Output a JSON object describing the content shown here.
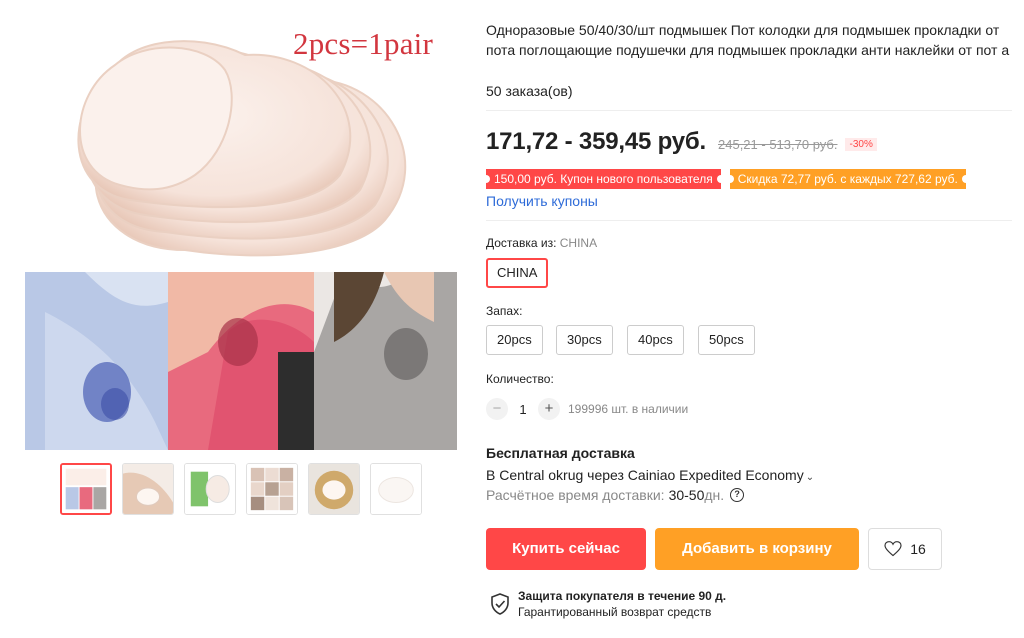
{
  "gallery": {
    "caption": "2pcs=1pair",
    "thumbnails": [
      {
        "name": "thumb-collage",
        "active": true
      },
      {
        "name": "thumb-pad-on-arm",
        "active": false
      },
      {
        "name": "thumb-pad-application",
        "active": false
      },
      {
        "name": "thumb-pad-grid",
        "active": false
      },
      {
        "name": "thumb-pad-on-plate",
        "active": false
      },
      {
        "name": "thumb-single-pad",
        "active": false
      }
    ]
  },
  "product": {
    "title": "Одноразовые 50/40/30/шт подмышек Пот колодки для подмышек прокладки от пота поглощающие подушечки для подмышек прокладки анти наклейки от пот а",
    "orders": "50 заказа(ов)",
    "price": "171,72 - 359,45 руб.",
    "old_price": "245,21 - 513,70 руб.",
    "discount": "-30%",
    "coupon_new_user": "150,00 руб. Купон нового пользователя",
    "coupon_store": "Скидка 72,77 руб. с каждых 727,62 руб.",
    "get_coupons": "Получить купоны"
  },
  "delivery_from": {
    "label": "Доставка из:",
    "value": "CHINA",
    "options": [
      "CHINA"
    ]
  },
  "scent": {
    "label": "Запах:",
    "options": [
      "20pcs",
      "30pcs",
      "40pcs",
      "50pcs"
    ]
  },
  "quantity": {
    "label": "Количество:",
    "minus": "−",
    "plus": "+",
    "value": "1",
    "stock": "199996 шт. в наличии"
  },
  "shipping": {
    "title": "Бесплатная доставка",
    "line": "В Central okrug через Cainiao Expedited Economy",
    "eta_label": "Расчётное время доставки:",
    "eta_value": "30-50",
    "eta_unit": "дн.",
    "help_icon": "?"
  },
  "actions": {
    "buy_now": "Купить сейчас",
    "add_to_cart": "Добавить в корзину",
    "wishlist_count": "16"
  },
  "protection": {
    "title": "Защита покупателя в течение 90 д.",
    "subtitle": "Гарантированный возврат средств"
  },
  "colors": {
    "accent_red": "#ff4747",
    "accent_orange": "#ffa025",
    "link_blue": "#2e6bd8"
  }
}
